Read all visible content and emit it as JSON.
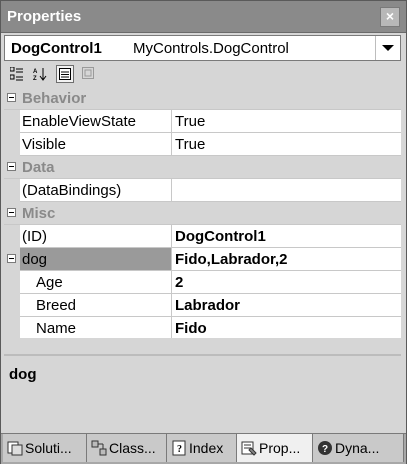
{
  "window": {
    "title": "Properties",
    "close_glyph": "×"
  },
  "object_selector": {
    "name": "DogControl1",
    "type": "MyControls.DogControl"
  },
  "toolbar": {
    "buttons": [
      "categorized-icon",
      "alphabetical-icon",
      "properties-icon",
      "events-icon"
    ]
  },
  "grid": {
    "categories": {
      "behavior": "Behavior",
      "data": "Data",
      "misc": "Misc"
    },
    "rows": {
      "enable_view_state": {
        "name": "EnableViewState",
        "value": "True"
      },
      "visible": {
        "name": "Visible",
        "value": "True"
      },
      "data_bindings": {
        "name": "(DataBindings)",
        "value": ""
      },
      "id": {
        "name": "(ID)",
        "value": "DogControl1"
      },
      "dog": {
        "name": "dog",
        "value": "Fido,Labrador,2"
      },
      "age": {
        "name": "Age",
        "value": "2"
      },
      "breed": {
        "name": "Breed",
        "value": "Labrador"
      },
      "name": {
        "name": "Name",
        "value": "Fido"
      }
    }
  },
  "description": {
    "title": "dog"
  },
  "tabs": [
    {
      "label": "Soluti...",
      "icon": "solution-icon"
    },
    {
      "label": "Class...",
      "icon": "class-view-icon"
    },
    {
      "label": "Index",
      "icon": "index-icon"
    },
    {
      "label": "Prop...",
      "icon": "properties-icon"
    },
    {
      "label": "Dyna...",
      "icon": "dynamic-help-icon"
    }
  ],
  "colors": {
    "titlebar": "#8a8a8a",
    "selected_row": "#9a9a9a",
    "panel": "#d6d6d6"
  }
}
